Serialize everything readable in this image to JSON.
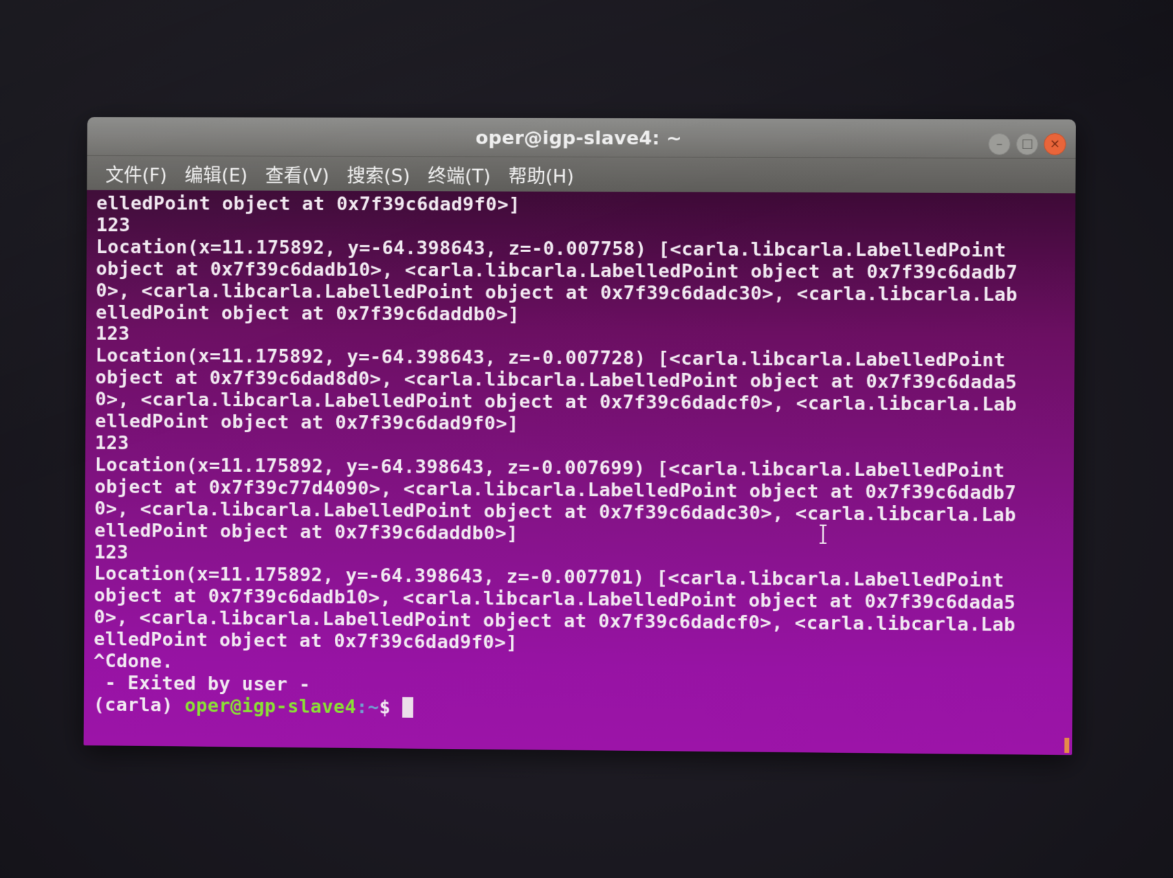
{
  "window": {
    "title": "oper@igp-slave4: ~",
    "controls": {
      "minimize_glyph": "–",
      "maximize_glyph": "□",
      "close_glyph": "×"
    }
  },
  "menu": [
    {
      "label": "文件(F)"
    },
    {
      "label": "编辑(E)"
    },
    {
      "label": "查看(V)"
    },
    {
      "label": "搜索(S)"
    },
    {
      "label": "终端(T)"
    },
    {
      "label": "帮助(H)"
    }
  ],
  "terminal": {
    "lines": [
      "elledPoint object at 0x7f39c6dad9f0>]",
      "123",
      "Location(x=11.175892, y=-64.398643, z=-0.007758) [<carla.libcarla.LabelledPoint",
      "object at 0x7f39c6dadb10>, <carla.libcarla.LabelledPoint object at 0x7f39c6dadb7",
      "0>, <carla.libcarla.LabelledPoint object at 0x7f39c6dadc30>, <carla.libcarla.Lab",
      "elledPoint object at 0x7f39c6daddb0>]",
      "123",
      "Location(x=11.175892, y=-64.398643, z=-0.007728) [<carla.libcarla.LabelledPoint",
      "object at 0x7f39c6dad8d0>, <carla.libcarla.LabelledPoint object at 0x7f39c6dada5",
      "0>, <carla.libcarla.LabelledPoint object at 0x7f39c6dadcf0>, <carla.libcarla.Lab",
      "elledPoint object at 0x7f39c6dad9f0>]",
      "123",
      "Location(x=11.175892, y=-64.398643, z=-0.007699) [<carla.libcarla.LabelledPoint",
      "object at 0x7f39c77d4090>, <carla.libcarla.LabelledPoint object at 0x7f39c6dadb7",
      "0>, <carla.libcarla.LabelledPoint object at 0x7f39c6dadc30>, <carla.libcarla.Lab",
      "elledPoint object at 0x7f39c6daddb0>]",
      "123",
      "Location(x=11.175892, y=-64.398643, z=-0.007701) [<carla.libcarla.LabelledPoint",
      "object at 0x7f39c6dadb10>, <carla.libcarla.LabelledPoint object at 0x7f39c6dada5",
      "0>, <carla.libcarla.LabelledPoint object at 0x7f39c6dadcf0>, <carla.libcarla.Lab",
      "elledPoint object at 0x7f39c6dad9f0>]",
      "^Cdone.",
      " - Exited by user -"
    ],
    "prompt": {
      "env": "(carla) ",
      "user_host": "oper@igp-slave4",
      "path": ":~",
      "symbol": "$ "
    }
  },
  "colors": {
    "terminal_bg": "#86138a",
    "terminal_fg": "#f2eaf2",
    "prompt_user": "#8ae234",
    "prompt_path": "#729fcf",
    "titlebar": "#7a7977",
    "close_button": "#e9653a"
  }
}
